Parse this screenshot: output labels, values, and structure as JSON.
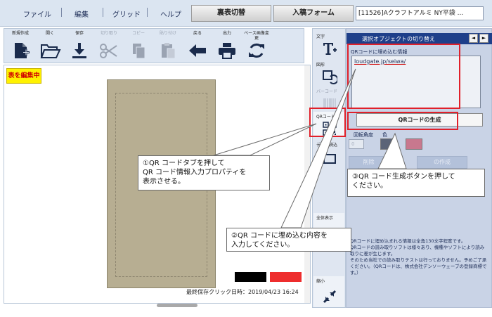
{
  "menu": {
    "items": [
      "ファイル",
      "編集",
      "グリッド",
      "ヘルプ"
    ],
    "tabs": [
      "裏表切替",
      "入稿フォーム"
    ],
    "doc_select": "[11526]Aクラフトアルミ NY平袋 ..."
  },
  "toolbar": {
    "tools": [
      {
        "label": "新規作成",
        "icon": "new-document-icon",
        "enabled": true
      },
      {
        "label": "開く",
        "icon": "folder-open-icon",
        "enabled": true
      },
      {
        "label": "保存",
        "icon": "download-icon",
        "enabled": true
      },
      {
        "label": "切り取り",
        "icon": "scissors-icon",
        "enabled": false
      },
      {
        "label": "コピー",
        "icon": "copy-icon",
        "enabled": false
      },
      {
        "label": "貼り付け",
        "icon": "paste-icon",
        "enabled": false
      },
      {
        "label": "戻る",
        "icon": "arrow-left-icon",
        "enabled": true
      },
      {
        "label": "出力",
        "icon": "printer-icon",
        "enabled": true
      },
      {
        "label": "ベース画像変更",
        "icon": "refresh-icon",
        "enabled": true
      }
    ]
  },
  "canvas": {
    "edit_badge": "表を編集中",
    "status": "最終保存クリック日時：2019/04/23 16:24",
    "swatch_colors": [
      "#000000",
      "#ee2d2d"
    ],
    "card_color": "#b7ae92"
  },
  "side_tabs": [
    {
      "label": "文字",
      "icon": "text-tool-icon"
    },
    {
      "label": "図形",
      "icon": "shape-tool-icon"
    },
    {
      "label": "バーコード",
      "icon": "barcode-icon"
    },
    {
      "label": "QRコード",
      "icon": "qr-code-icon"
    },
    {
      "label": "データ読込",
      "icon": "data-import-icon"
    },
    {
      "label": "全体表示",
      "icon": "expand-icon"
    },
    {
      "label": "縮小",
      "icon": "shrink-icon"
    }
  ],
  "props": {
    "title": "選択オブジェクトの切り替え",
    "prev": "◄",
    "next": "►",
    "qr_info_label": "QRコードに埋め込む情報",
    "qr_value": "loudgate.jp/seiwa/",
    "generate_button": "QRコードの生成",
    "rotation_label": "回転角度",
    "color_label": "色",
    "rotation_value": "0",
    "color_boxes": [
      "#5b6477",
      "#c8788e"
    ],
    "ghost_buttons": [
      "削除",
      "の作成"
    ],
    "notes": "QRコードに埋め込まれる情報は全角130文字程度です。\nQRコードの読み取りソフトは様々あり、機種やソフトにより読み取りに差が生じます。\nそのため当社での読み取りテストは行っておりません。予めご了承ください。（QRコードは、株式会社デンソーウェーブの登録商標です。）"
  },
  "annotations": {
    "a1": "①QR コードタブを押して\nQR コード情報入力プロパティを\n表示させる。",
    "a2": "②QR コードに埋め込む内容を\n入力してください。",
    "a3": "③QR コード生成ボタンを押して\nください。",
    "accent_color": "#e0202a"
  }
}
